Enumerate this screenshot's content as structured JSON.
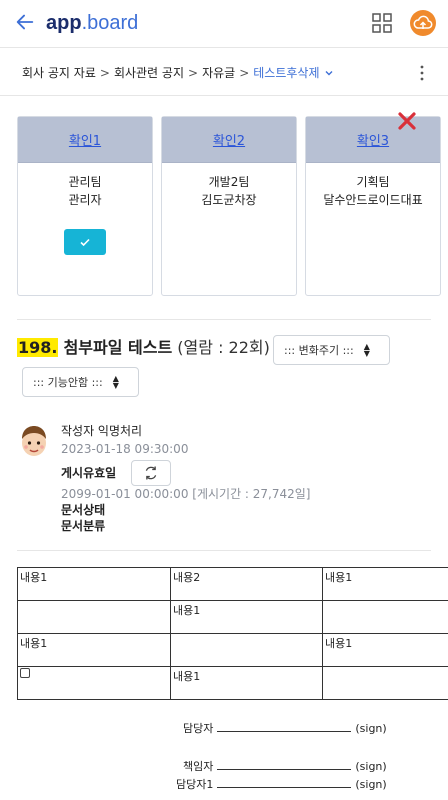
{
  "app": {
    "brand_bold": "app",
    "brand_rest": ".board",
    "accent": "#3d6fd6",
    "cloud_color": "#f08a2c"
  },
  "breadcrumb": {
    "items": [
      "회사 공지 자료",
      "회사관련 공지",
      "자유글"
    ],
    "current": "테스트후삭제"
  },
  "approvals": [
    {
      "title": "확인1",
      "team": "관리팀",
      "person": "관리자",
      "checked": true
    },
    {
      "title": "확인2",
      "team": "개발2팀",
      "person": "김도균차장",
      "checked": false
    },
    {
      "title": "확인3",
      "team": "기획팀",
      "person": "달수안드로이드대표",
      "checked": false
    }
  ],
  "post": {
    "number": "198.",
    "title": "첨부파일 테스트",
    "views": "(열람 : 22회)",
    "select_cycle": "::: 변화주기 :::",
    "select_function": "::: 기능안함 :::",
    "author": "작성자 익명처리",
    "created": "2023-01-18 09:30:00",
    "valid_label": "게시유효일",
    "valid_until": "2099-01-01 00:00:00 [게시기간 : 27,742일]",
    "doc_status": "문서상태",
    "doc_class": "문서분류"
  },
  "table": {
    "rows": [
      [
        "내용1",
        "내용2",
        "내용1"
      ],
      [
        "",
        "내용1",
        ""
      ],
      [
        "내용1",
        "",
        "내용1"
      ],
      [
        "",
        "내용1",
        ""
      ]
    ]
  },
  "signatures": {
    "manager": "담당자",
    "responsible": "책임자",
    "manager1": "담당자1",
    "sign": "(sign)"
  }
}
